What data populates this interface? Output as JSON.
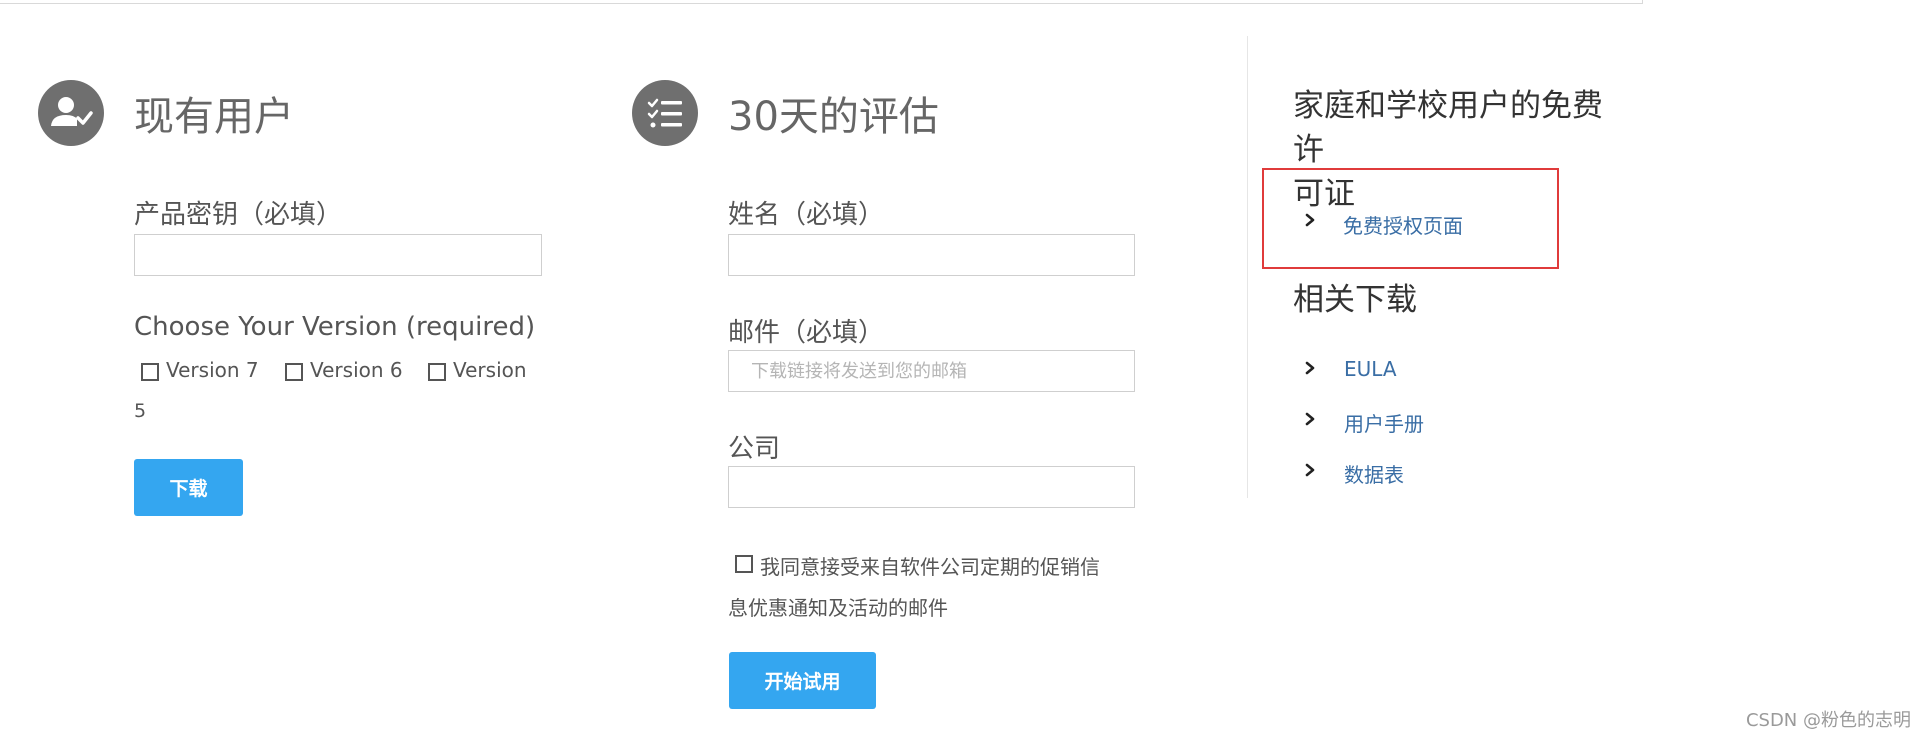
{
  "existing_user": {
    "heading": "现有用户",
    "product_key_label": "产品密钥（必填）",
    "product_key_value": "",
    "version_label": "Choose Your Version (required)",
    "versions": [
      "Version 7",
      "Version 6",
      "Version",
      "5"
    ],
    "download_button": "下载"
  },
  "trial": {
    "heading": "30天的评估",
    "name_label": "姓名（必填）",
    "email_label": "邮件（必填）",
    "email_placeholder": "下载链接将发送到您的邮箱",
    "company_label": "公司",
    "consent_line1": "我同意接受来自软件公司定期的促销信",
    "consent_line2": "息优惠通知及活动的邮件",
    "start_button": "开始试用"
  },
  "sidebar": {
    "free_license_heading_line1": "家庭和学校用户的免费许",
    "free_license_heading_line2": "可证",
    "free_license_link": "免费授权页面",
    "downloads_heading": "相关下载",
    "links": [
      "EULA",
      "用户手册",
      "数据表"
    ]
  },
  "watermark": "CSDN @粉色的志明",
  "colors": {
    "button": "#34a6f0",
    "link": "#3a6ea5",
    "highlight": "#e03b3b",
    "icon_bg": "#6f6f6f"
  },
  "icons": {
    "existing_user": "user-check-icon",
    "trial": "checklist-icon",
    "link_bullet": "chevron-right-icon"
  }
}
